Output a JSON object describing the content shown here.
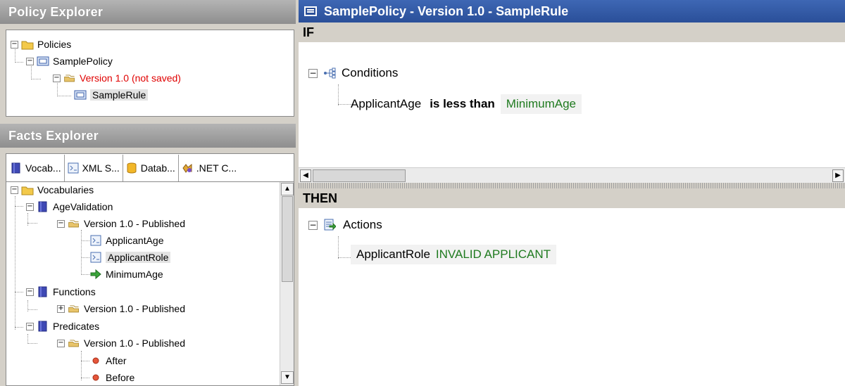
{
  "policy_explorer": {
    "title": "Policy Explorer",
    "tree": {
      "root": "Policies",
      "policy": "SamplePolicy",
      "version": "Version 1.0 (not saved)",
      "rule": "SampleRule"
    }
  },
  "facts_explorer": {
    "title": "Facts Explorer",
    "tabs": [
      {
        "label": "Vocab..."
      },
      {
        "label": "XML S..."
      },
      {
        "label": "Datab..."
      },
      {
        "label": ".NET C..."
      }
    ],
    "tree": {
      "root": "Vocabularies",
      "age_validation": {
        "label": "AgeValidation",
        "version": "Version 1.0 - Published",
        "items": [
          "ApplicantAge",
          "ApplicantRole",
          "MinimumAge"
        ]
      },
      "functions": {
        "label": "Functions",
        "version": "Version 1.0 - Published"
      },
      "predicates": {
        "label": "Predicates",
        "version": "Version 1.0 - Published",
        "items": [
          "After",
          "Before"
        ]
      }
    }
  },
  "editor": {
    "title": "SamplePolicy - Version 1.0 - SampleRule",
    "if_label": "IF",
    "conditions_label": "Conditions",
    "condition": {
      "left": "ApplicantAge",
      "operator": "is less than",
      "right": "MinimumAge"
    },
    "then_label": "THEN",
    "actions_label": "Actions",
    "action": {
      "target": "ApplicantRole",
      "value": "INVALID APPLICANT"
    }
  },
  "colors": {
    "title_bar": "#2f55a0",
    "not_saved": "#e00000",
    "value_green": "#1f7a1f"
  }
}
